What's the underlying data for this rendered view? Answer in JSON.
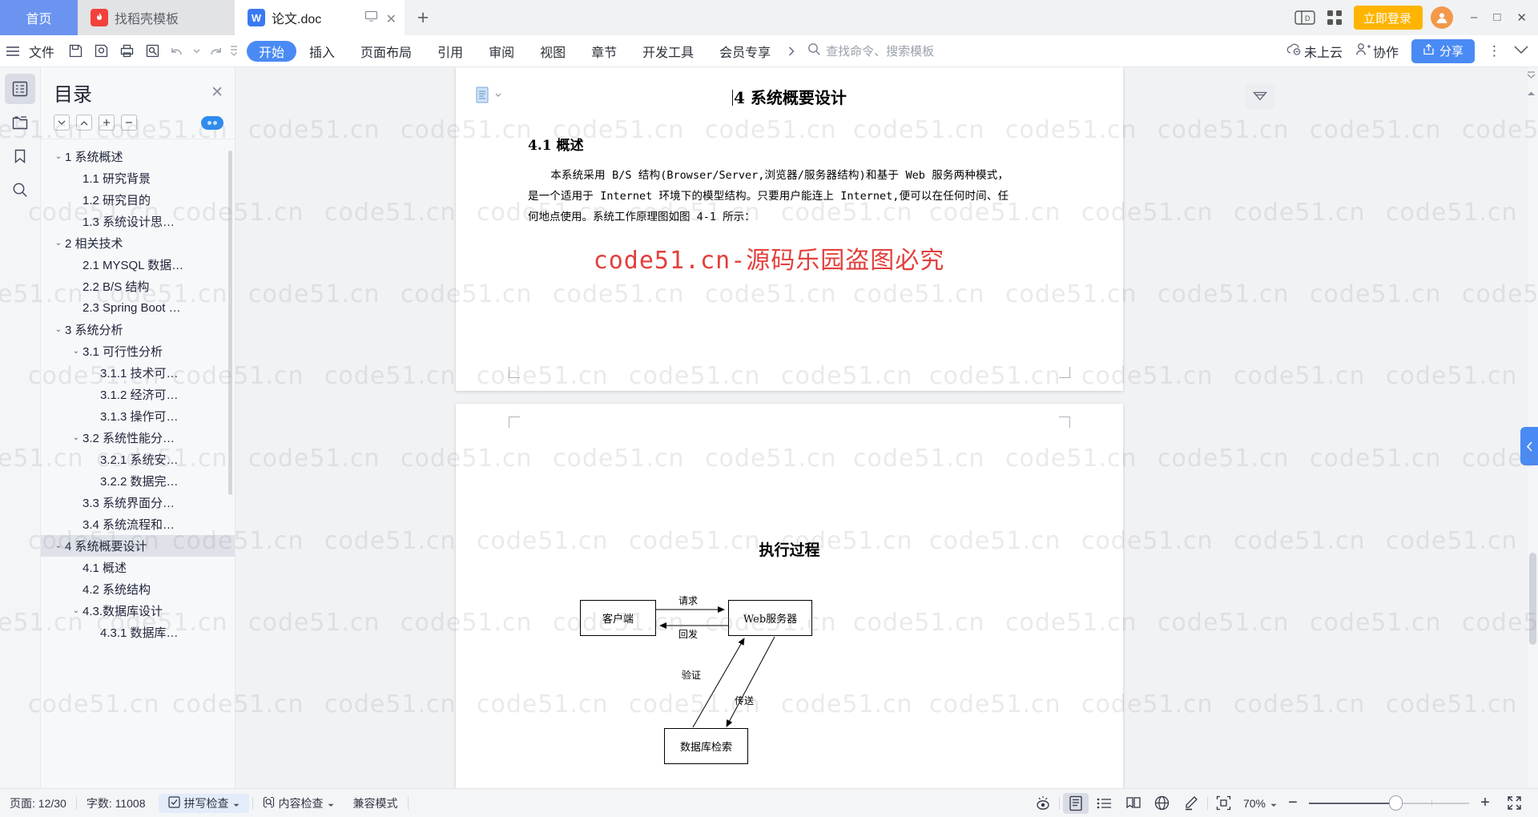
{
  "tabs": [
    {
      "label": "首页",
      "icon": "home-tab",
      "active": false
    },
    {
      "label": "找稻壳模板",
      "icon": "docer-icon",
      "active": false
    },
    {
      "label": "论文.doc",
      "icon": "wps-writer-icon",
      "active": true
    }
  ],
  "titlebar": {
    "new_tab": "+",
    "login_label": "立即登录",
    "minimize": "–",
    "maximize": "□",
    "close": "✕"
  },
  "ribbon": {
    "file_label": "文件",
    "tabs": [
      {
        "label": "开始",
        "active": true
      },
      {
        "label": "插入",
        "active": false
      },
      {
        "label": "页面布局",
        "active": false
      },
      {
        "label": "引用",
        "active": false
      },
      {
        "label": "审阅",
        "active": false
      },
      {
        "label": "视图",
        "active": false
      },
      {
        "label": "章节",
        "active": false
      },
      {
        "label": "开发工具",
        "active": false
      },
      {
        "label": "会员专享",
        "active": false
      }
    ],
    "search_placeholder": "查找命令、搜索模板",
    "cloud_status": "未上云",
    "collab_label": "协作",
    "share_label": "分享",
    "more_dots": "⋮"
  },
  "rail": [
    {
      "name": "outline-icon",
      "active": true
    },
    {
      "name": "thumbnail-icon",
      "active": false
    },
    {
      "name": "bookmark-icon",
      "active": false
    },
    {
      "name": "search-icon",
      "active": false
    }
  ],
  "toc": {
    "title": "目录",
    "close_label": "✕",
    "tools": [
      "expand-down",
      "collapse-up",
      "plus",
      "minus"
    ],
    "items": [
      {
        "label": "1 系统概述",
        "indent": 0,
        "caret": "⌄",
        "selected": false
      },
      {
        "label": "1.1  研究背景",
        "indent": 1,
        "caret": "",
        "selected": false
      },
      {
        "label": "1.2 研究目的",
        "indent": 1,
        "caret": "",
        "selected": false
      },
      {
        "label": "1.3 系统设计思…",
        "indent": 1,
        "caret": "",
        "selected": false
      },
      {
        "label": "2 相关技术",
        "indent": 0,
        "caret": "⌄",
        "selected": false
      },
      {
        "label": "2.1 MYSQL 数据…",
        "indent": 1,
        "caret": "",
        "selected": false
      },
      {
        "label": "2.2 B/S 结构",
        "indent": 1,
        "caret": "",
        "selected": false
      },
      {
        "label": "2.3 Spring Boot …",
        "indent": 1,
        "caret": "",
        "selected": false
      },
      {
        "label": "3 系统分析",
        "indent": 0,
        "caret": "⌄",
        "selected": false
      },
      {
        "label": "3.1 可行性分析",
        "indent": 1,
        "caret": "⌄",
        "selected": false
      },
      {
        "label": "3.1.1 技术可…",
        "indent": 2,
        "caret": "",
        "selected": false
      },
      {
        "label": "3.1.2 经济可…",
        "indent": 2,
        "caret": "",
        "selected": false
      },
      {
        "label": "3.1.3 操作可…",
        "indent": 2,
        "caret": "",
        "selected": false
      },
      {
        "label": "3.2 系统性能分…",
        "indent": 1,
        "caret": "⌄",
        "selected": false
      },
      {
        "label": "3.2.1  系统安…",
        "indent": 2,
        "caret": "",
        "selected": false
      },
      {
        "label": "3.2.2  数据完…",
        "indent": 2,
        "caret": "",
        "selected": false
      },
      {
        "label": "3.3 系统界面分…",
        "indent": 1,
        "caret": "",
        "selected": false
      },
      {
        "label": "3.4 系统流程和…",
        "indent": 1,
        "caret": "",
        "selected": false
      },
      {
        "label": "4 系统概要设计",
        "indent": 0,
        "caret": "⌄",
        "selected": true
      },
      {
        "label": "4.1 概述",
        "indent": 1,
        "caret": "",
        "selected": false
      },
      {
        "label": "4.2 系统结构",
        "indent": 1,
        "caret": "",
        "selected": false
      },
      {
        "label": "4.3.数据库设计",
        "indent": 1,
        "caret": "⌄",
        "selected": false
      },
      {
        "label": "4.3.1 数据库…",
        "indent": 2,
        "caret": "",
        "selected": false
      }
    ]
  },
  "document": {
    "heading1": "4 系统概要设计",
    "heading2": "4.1 概述",
    "paragraph": "本系统采用 B/S 结构(Browser/Server,浏览器/服务器结构)和基于 Web 服务两种模式，是一个适用于 Internet 环境下的模型结构。只要用户能连上 Internet,便可以在任何时间、任何地点使用。系统工作原理图如图 4-1 所示：",
    "watermark_stamp": "code51.cn-源码乐园盗图必究",
    "figure": {
      "title": "执行过程",
      "nodes": [
        {
          "id": "client",
          "label": "客户端"
        },
        {
          "id": "webserver",
          "label": "Web服务器"
        },
        {
          "id": "database",
          "label": "数据库检索"
        }
      ],
      "edges": [
        {
          "label": "请求",
          "from": "client",
          "to": "webserver"
        },
        {
          "label": "回发",
          "from": "webserver",
          "to": "client"
        },
        {
          "label": "验证",
          "from": "database",
          "to": "webserver"
        },
        {
          "label": "传送",
          "from": "webserver",
          "to": "database"
        }
      ]
    }
  },
  "statusbar": {
    "page_label": "页面: 12/30",
    "words_label": "字数: 11008",
    "spellcheck_label": "拼写检查",
    "contentcheck_label": "内容检查",
    "compat_label": "兼容模式",
    "zoom_label": "70%",
    "zoom_minus": "−",
    "zoom_plus": "+",
    "views": [
      {
        "name": "eye-focus-icon",
        "active": false
      },
      {
        "name": "page-view-icon",
        "active": true
      },
      {
        "name": "outline-view-icon",
        "active": false
      },
      {
        "name": "read-view-icon",
        "active": false
      },
      {
        "name": "web-view-icon",
        "active": false
      },
      {
        "name": "pen-view-icon",
        "active": false
      }
    ]
  },
  "watermarks": {
    "text": "code51.cn",
    "stamp_color": "#e2403c"
  }
}
